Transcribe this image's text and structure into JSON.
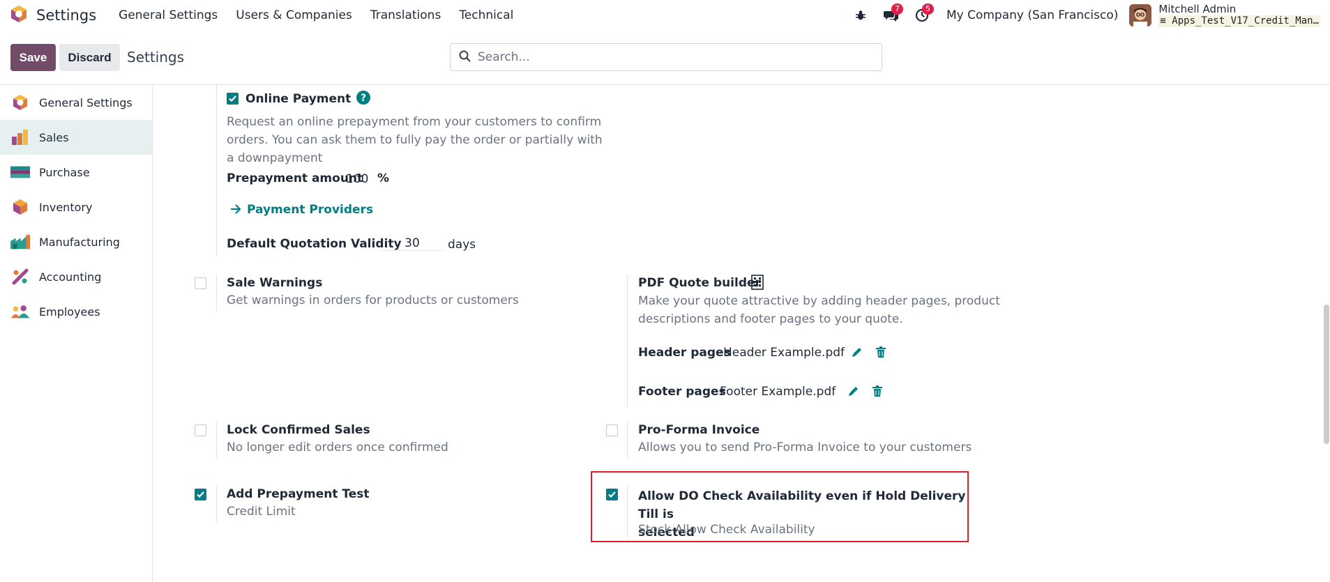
{
  "navbar": {
    "app_title": "Settings",
    "menu": [
      "General Settings",
      "Users & Companies",
      "Translations",
      "Technical"
    ],
    "chat_badge": "7",
    "activity_badge": "5",
    "company": "My Company (San Francisco)",
    "user_name": "Mitchell Admin",
    "db_name": "Apps_Test_V17_Credit_Man…"
  },
  "control_panel": {
    "save_label": "Save",
    "discard_label": "Discard",
    "breadcrumb": "Settings",
    "search_placeholder": "Search..."
  },
  "sidebar": {
    "items": [
      {
        "label": "General Settings",
        "icon": "settings-app-icon"
      },
      {
        "label": "Sales",
        "icon": "sales-app-icon",
        "active": true
      },
      {
        "label": "Purchase",
        "icon": "purchase-app-icon"
      },
      {
        "label": "Inventory",
        "icon": "inventory-app-icon"
      },
      {
        "label": "Manufacturing",
        "icon": "manufacturing-app-icon"
      },
      {
        "label": "Accounting",
        "icon": "accounting-app-icon"
      },
      {
        "label": "Employees",
        "icon": "employees-app-icon"
      }
    ]
  },
  "settings": {
    "online_payment": {
      "title": "Online Payment",
      "checked": true,
      "desc_lines": [
        "Request an online prepayment from your customers to confirm",
        "orders. You can ask them to fully pay the order or partially with",
        "a downpayment"
      ],
      "prepayment_label": "Prepayment amount",
      "prepayment_value": "100",
      "prepayment_unit": "%",
      "providers_link": "Payment Providers"
    },
    "quotation_validity": {
      "label": "Default Quotation Validity",
      "value": "30",
      "unit": "days"
    },
    "sale_warnings": {
      "title": "Sale Warnings",
      "checked": false,
      "desc": "Get warnings in orders for products or customers"
    },
    "pdf_quote_builder": {
      "title": "PDF Quote builder",
      "desc_lines": [
        "Make your quote attractive by adding header pages, product",
        "descriptions and footer pages to your quote."
      ],
      "header_label": "Header pages",
      "header_file": "Header Example.pdf",
      "footer_label": "Footer pages",
      "footer_file": "Footer Example.pdf"
    },
    "lock_confirmed_sales": {
      "title": "Lock Confirmed Sales",
      "checked": false,
      "desc": "No longer edit orders once confirmed"
    },
    "pro_forma": {
      "title": "Pro-Forma Invoice",
      "checked": false,
      "desc": "Allows you to send Pro-Forma Invoice to your customers"
    },
    "add_prepayment_test": {
      "title": "Add Prepayment Test",
      "checked": true,
      "desc": "Credit Limit"
    },
    "allow_do_check": {
      "title_lines": [
        "Allow DO Check Availability even if Hold Delivery Till is",
        "selected"
      ],
      "checked": true,
      "desc": "Stock Allow Check Availability"
    }
  },
  "colors": {
    "brand": "#714B67",
    "accent": "#017e84",
    "highlight": "#e11d2a",
    "badge": "#e11d48"
  }
}
